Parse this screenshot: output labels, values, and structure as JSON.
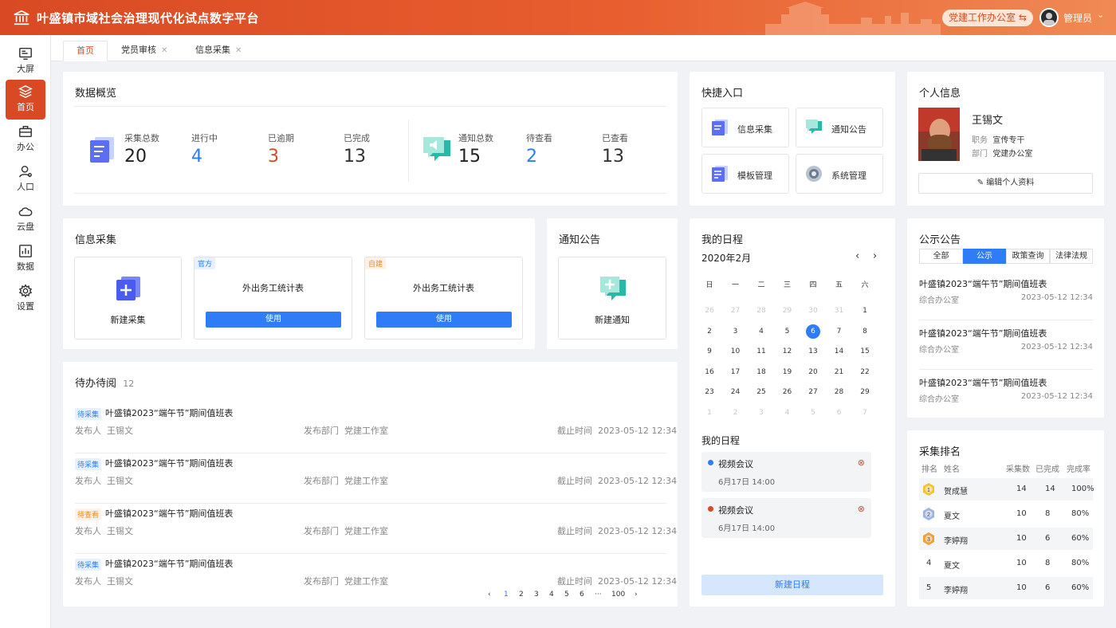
{
  "header": {
    "title": "叶盛镇市域社会治理现代化试点数字平台",
    "office_button": "党建工作办公室 ⇆",
    "admin": "管理员"
  },
  "sidebar": [
    {
      "label": "大屏",
      "icon": "screen-icon"
    },
    {
      "label": "首页",
      "icon": "layers-icon",
      "active": true
    },
    {
      "label": "办公",
      "icon": "briefcase-icon"
    },
    {
      "label": "人口",
      "icon": "user-icon"
    },
    {
      "label": "云盘",
      "icon": "cloud-icon"
    },
    {
      "label": "数据",
      "icon": "chart-icon"
    },
    {
      "label": "设置",
      "icon": "gear-icon"
    }
  ],
  "tabs": [
    "首页",
    "党员审核",
    "信息采集"
  ],
  "overview": {
    "title": "数据概览",
    "collect": [
      {
        "label": "采集总数",
        "value": "20",
        "color": "#222222"
      },
      {
        "label": "进行中",
        "value": "4",
        "color": "#2e7cf6"
      },
      {
        "label": "已逾期",
        "value": "3",
        "color": "#d94a24"
      },
      {
        "label": "已完成",
        "value": "13",
        "color": "#333333"
      }
    ],
    "notice": [
      {
        "label": "通知总数",
        "value": "15",
        "color": "#222222"
      },
      {
        "label": "待查看",
        "value": "2",
        "color": "#2e7cf6"
      },
      {
        "label": "已查看",
        "value": "13",
        "color": "#333333"
      }
    ]
  },
  "quick": {
    "title": "快捷入口",
    "items": [
      "信息采集",
      "通知公告",
      "模板管理",
      "系统管理"
    ]
  },
  "profile": {
    "title": "个人信息",
    "name": "王锡文",
    "role_label": "职务",
    "role": "宣传专干",
    "dept_label": "部门",
    "dept": "党建办公室",
    "edit": "编辑个人资料"
  },
  "collect_card": {
    "title": "信息采集",
    "new_label": "新建采集",
    "tiles": [
      {
        "badge": "官方",
        "name": "外出务工统计表",
        "button": "使用"
      },
      {
        "badge": "自建",
        "name": "外出务工统计表",
        "button": "使用"
      }
    ]
  },
  "notice_card": {
    "title": "通知公告",
    "new_label": "新建通知"
  },
  "schedule": {
    "title": "我的日程",
    "month": "2020年2月",
    "weekdays": [
      "日",
      "一",
      "二",
      "三",
      "四",
      "五",
      "六"
    ],
    "days": [
      [
        "26",
        "27",
        "28",
        "29",
        "30",
        "31",
        "1"
      ],
      [
        "2",
        "3",
        "4",
        "5",
        "6",
        "7",
        "8"
      ],
      [
        "9",
        "10",
        "11",
        "12",
        "13",
        "14",
        "15"
      ],
      [
        "16",
        "17",
        "18",
        "19",
        "20",
        "21",
        "22"
      ],
      [
        "23",
        "24",
        "25",
        "26",
        "27",
        "28",
        "29"
      ],
      [
        "1",
        "2",
        "3",
        "4",
        "5",
        "6",
        "7"
      ]
    ],
    "selected_day": "6",
    "list_title": "我的日程",
    "items": [
      {
        "title": "视频会议",
        "time": "6月17日 14:00",
        "color": "#2e7cf6"
      },
      {
        "title": "视频会议",
        "time": "6月17日 14:00",
        "color": "#d94a24"
      }
    ],
    "new_button": "新建日程"
  },
  "notices": {
    "title": "公示公告",
    "tabs": [
      "全部",
      "公示",
      "政策查询",
      "法律法规"
    ],
    "active_tab": "公示",
    "items": [
      {
        "title": "叶盛镇2023“端午节”期间值班表",
        "dept": "综合办公室",
        "time": "2023-05-12 12:34"
      },
      {
        "title": "叶盛镇2023“端午节”期间值班表",
        "dept": "综合办公室",
        "time": "2023-05-12 12:34"
      },
      {
        "title": "叶盛镇2023“端午节”期间值班表",
        "dept": "综合办公室",
        "time": "2023-05-12 12:34"
      }
    ]
  },
  "todo": {
    "title": "待办待阅",
    "count": "12",
    "items": [
      {
        "tag": "待采集",
        "tag_color": "blue",
        "title": "叶盛镇2023“端午节”期间值班表",
        "pub_label": "发布人",
        "pub": "王锡文",
        "dept_label": "发布部门",
        "dept": "党建工作室",
        "due_label": "截止时间",
        "due": "2023-05-12 12:34"
      },
      {
        "tag": "待采集",
        "tag_color": "blue",
        "title": "叶盛镇2023“端午节”期间值班表",
        "pub_label": "发布人",
        "pub": "王锡文",
        "dept_label": "发布部门",
        "dept": "党建工作室",
        "due_label": "截止时间",
        "due": "2023-05-12 12:34"
      },
      {
        "tag": "待查看",
        "tag_color": "orange",
        "title": "叶盛镇2023“端午节”期间值班表",
        "pub_label": "发布人",
        "pub": "王锡文",
        "dept_label": "发布部门",
        "dept": "党建工作室",
        "due_label": "截止时间",
        "due": "2023-05-12 12:34"
      },
      {
        "tag": "待采集",
        "tag_color": "blue",
        "title": "叶盛镇2023“端午节”期间值班表",
        "pub_label": "发布人",
        "pub": "王锡文",
        "dept_label": "发布部门",
        "dept": "党建工作室",
        "due_label": "截止时间",
        "due": "2023-05-12 12:34"
      }
    ],
    "pager": {
      "prev": "‹",
      "pages": [
        "1",
        "2",
        "3",
        "4",
        "5",
        "6",
        "···",
        "100"
      ],
      "current": "1",
      "next": "›"
    }
  },
  "ranking": {
    "title": "采集排名",
    "headers": [
      "排名",
      "姓名",
      "采集数",
      "已完成",
      "完成率"
    ],
    "rows": [
      {
        "rank": "1",
        "name": "贺成慧",
        "total": "14",
        "done": "14",
        "rate": "100%",
        "medal": "gold"
      },
      {
        "rank": "2",
        "name": "夏文",
        "total": "10",
        "done": "8",
        "rate": "80%",
        "medal": "silver"
      },
      {
        "rank": "3",
        "name": "李婷翔",
        "total": "10",
        "done": "6",
        "rate": "60%",
        "medal": "bronze"
      },
      {
        "rank": "4",
        "name": "夏文",
        "total": "10",
        "done": "8",
        "rate": "80%"
      },
      {
        "rank": "5",
        "name": "李婷翔",
        "total": "10",
        "done": "6",
        "rate": "60%"
      }
    ]
  },
  "colors": {
    "brand": "#d94a24",
    "accent": "#2e7cf6"
  }
}
